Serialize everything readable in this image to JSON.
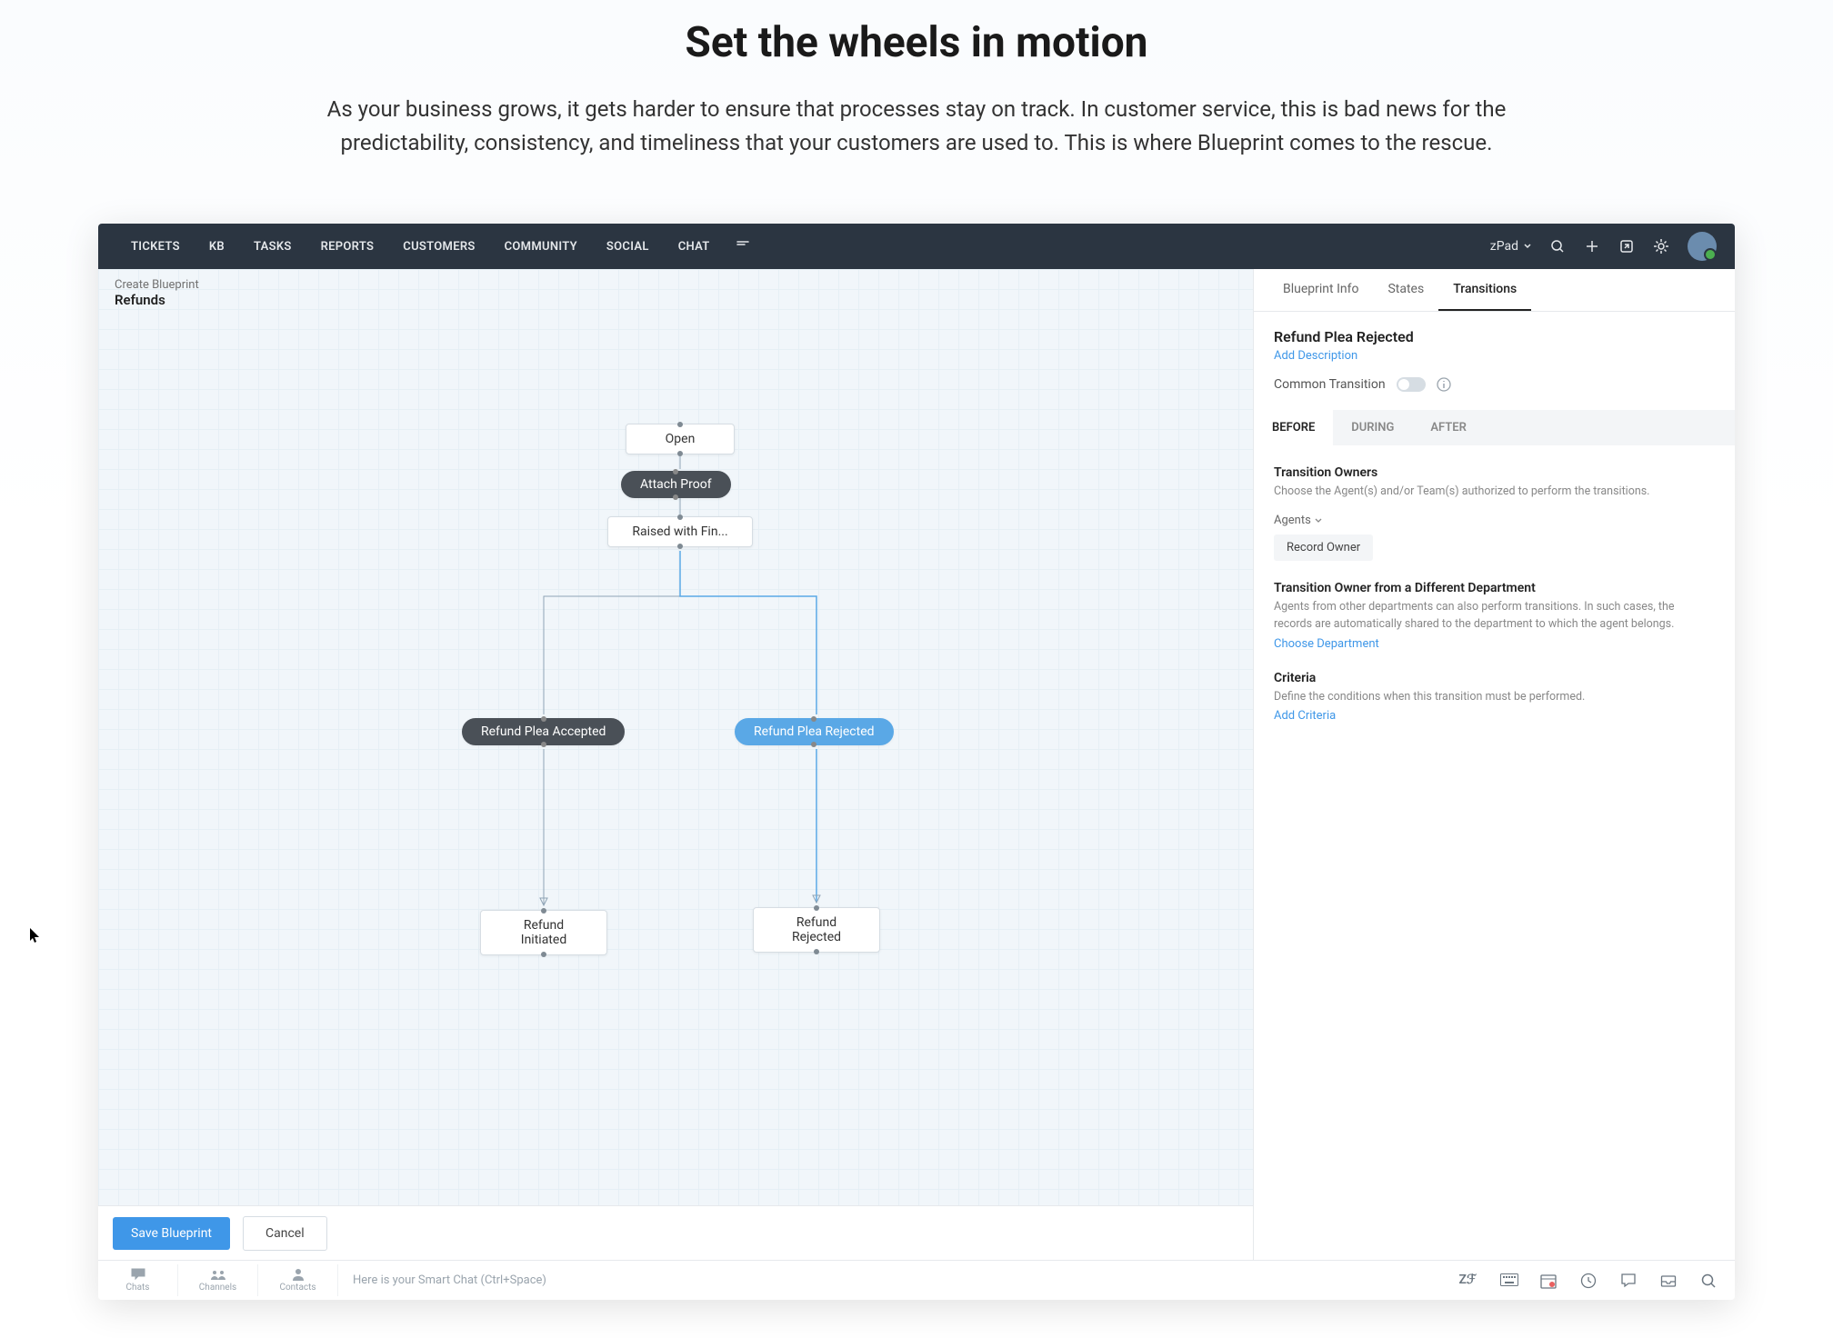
{
  "hero": {
    "title": "Set the wheels in motion",
    "subtitle": "As your business grows, it gets harder to ensure that processes stay on track. In customer service, this is bad news for the predictability, consistency, and timeliness that your customers are used to. This is where Blueprint comes to the rescue."
  },
  "nav": {
    "items": [
      "TICKETS",
      "KB",
      "TASKS",
      "REPORTS",
      "CUSTOMERS",
      "COMMUNITY",
      "SOCIAL",
      "CHAT"
    ],
    "brand": "zPad"
  },
  "canvas": {
    "subtitle": "Create Blueprint",
    "title": "Refunds",
    "nodes": {
      "open": "Open",
      "attach_proof": "Attach Proof",
      "raised_fin": "Raised with Fin...",
      "plea_accepted": "Refund Plea Accepted",
      "plea_rejected": "Refund Plea Rejected",
      "refund_initiated": "Refund Initiated",
      "refund_rejected": "Refund Rejected"
    },
    "save": "Save Blueprint",
    "cancel": "Cancel"
  },
  "panel": {
    "tabs": {
      "info": "Blueprint Info",
      "states": "States",
      "transitions": "Transitions"
    },
    "transition_name": "Refund Plea Rejected",
    "add_description": "Add Description",
    "common_transition": "Common Transition",
    "phases": {
      "before": "BEFORE",
      "during": "DURING",
      "after": "AFTER"
    },
    "owners": {
      "title": "Transition Owners",
      "desc": "Choose the Agent(s) and/or Team(s) authorized to perform the transitions.",
      "agents_label": "Agents",
      "chip": "Record Owner"
    },
    "diff_dept": {
      "title": "Transition Owner from a Different Department",
      "desc": "Agents from other departments can also perform transitions. In such cases, the records are automatically shared to the department to which the agent belongs.",
      "link": "Choose Department"
    },
    "criteria": {
      "title": "Criteria",
      "desc": "Define the conditions when this transition must be performed.",
      "link": "Add Criteria"
    }
  },
  "bottombar": {
    "items": [
      "Chats",
      "Channels",
      "Contacts"
    ],
    "smartchat": "Here is your Smart Chat (Ctrl+Space)"
  }
}
